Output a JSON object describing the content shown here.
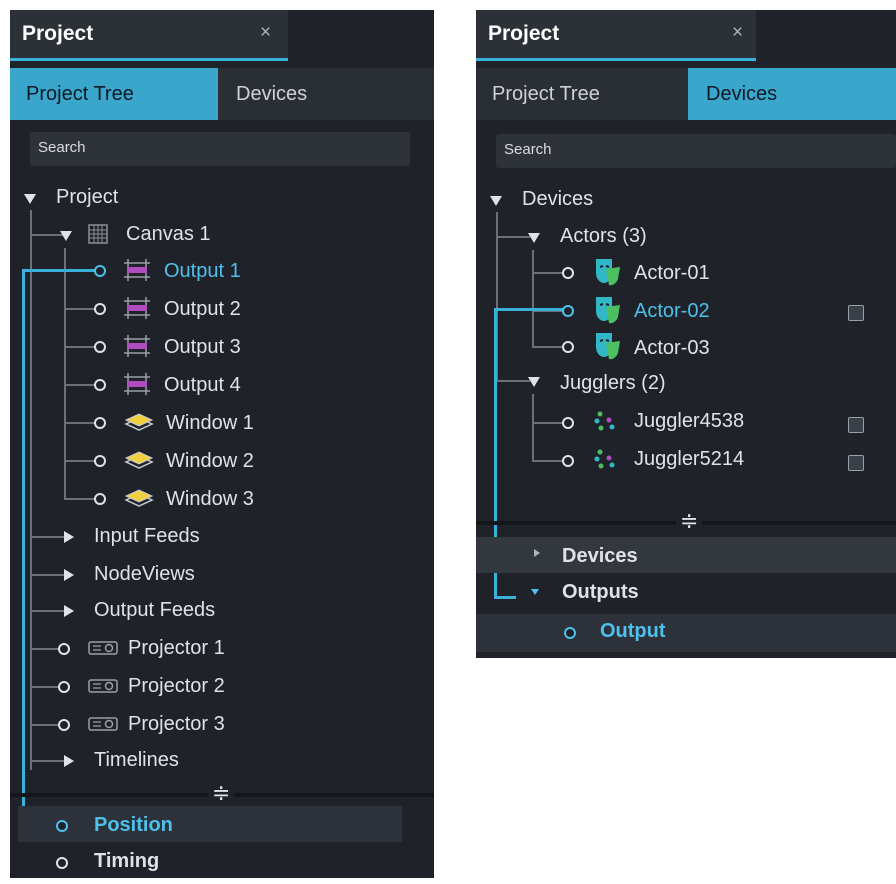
{
  "left": {
    "title": "Project",
    "close": "×",
    "tabs": [
      "Project Tree",
      "Devices"
    ],
    "search_placeholder": "Search",
    "tree": {
      "root": "Project",
      "canvas": "Canvas 1",
      "outputs": [
        "Output 1",
        "Output 2",
        "Output 3",
        "Output 4"
      ],
      "windows": [
        "Window 1",
        "Window 2",
        "Window 3"
      ],
      "folders": [
        "Input Feeds",
        "NodeViews",
        "Output Feeds"
      ],
      "projectors": [
        "Projector 1",
        "Projector 2",
        "Projector 3"
      ],
      "timelines": "Timelines"
    },
    "bottom": [
      "Position",
      "Timing"
    ]
  },
  "right": {
    "title": "Project",
    "close": "×",
    "tabs": [
      "Project Tree",
      "Devices"
    ],
    "search_placeholder": "Search",
    "tree": {
      "root": "Devices",
      "actors_group": "Actors (3)",
      "actors": [
        "Actor-01",
        "Actor-02",
        "Actor-03"
      ],
      "jugglers_group": "Jugglers (2)",
      "jugglers": [
        "Juggler4538",
        "Juggler5214"
      ]
    },
    "bottom": {
      "devices": "Devices",
      "outputs": "Outputs",
      "output": "Output"
    }
  },
  "colors": {
    "accent": "#3ab0dc",
    "panel_bg": "#1f2329",
    "selected_text": "#4ec0ec",
    "output_icon": "#b04cc0",
    "window_icon": "#f0d040",
    "actor_icon": "#30b8c8"
  }
}
